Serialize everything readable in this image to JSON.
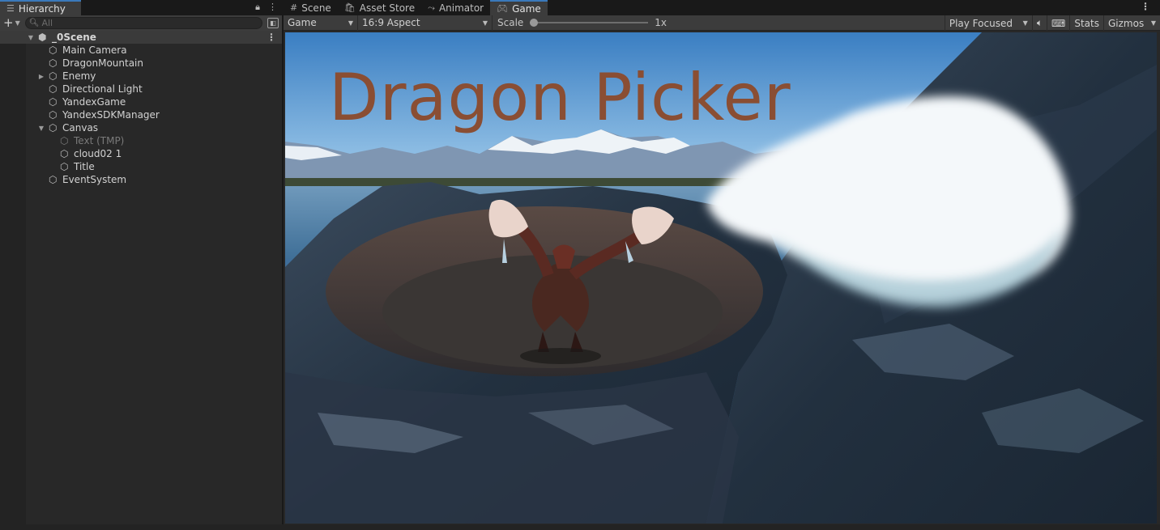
{
  "hierarchy": {
    "tab_label": "Hierarchy",
    "search": {
      "value": "",
      "placeholder": "All"
    },
    "scene": {
      "name": "_0Scene"
    },
    "items": [
      {
        "label": "Main Camera",
        "depth": 1,
        "arrow": "",
        "dim": false
      },
      {
        "label": "DragonMountain",
        "depth": 1,
        "arrow": "",
        "dim": false
      },
      {
        "label": "Enemy",
        "depth": 1,
        "arrow": "collapsed",
        "dim": false
      },
      {
        "label": "Directional Light",
        "depth": 1,
        "arrow": "",
        "dim": false
      },
      {
        "label": "YandexGame",
        "depth": 1,
        "arrow": "",
        "dim": false
      },
      {
        "label": "YandexSDKManager",
        "depth": 1,
        "arrow": "",
        "dim": false
      },
      {
        "label": "Canvas",
        "depth": 1,
        "arrow": "expanded",
        "dim": false
      },
      {
        "label": "Text (TMP)",
        "depth": 2,
        "arrow": "",
        "dim": true
      },
      {
        "label": "cloud02 1",
        "depth": 2,
        "arrow": "",
        "dim": false
      },
      {
        "label": "Title",
        "depth": 2,
        "arrow": "",
        "dim": false
      },
      {
        "label": "EventSystem",
        "depth": 1,
        "arrow": "",
        "dim": false
      }
    ]
  },
  "game_panel": {
    "tabs": [
      {
        "label": "Scene",
        "icon": "grid-icon",
        "active": false
      },
      {
        "label": "Asset Store",
        "icon": "bag-icon",
        "active": false
      },
      {
        "label": "Animator",
        "icon": "animator-icon",
        "active": false
      },
      {
        "label": "Game",
        "icon": "gamepad-icon",
        "active": true
      }
    ],
    "toolbar": {
      "display": "Game",
      "aspect": "16:9 Aspect",
      "scale_label": "Scale",
      "scale_value": "1x",
      "play_mode": "Play Focused",
      "stats": "Stats",
      "gizmos": "Gizmos"
    },
    "game_title": "Dragon Picker"
  },
  "colors": {
    "panel_bg": "#282828",
    "tab_accent": "#3a79bb",
    "title_text": "#8a4e33"
  }
}
